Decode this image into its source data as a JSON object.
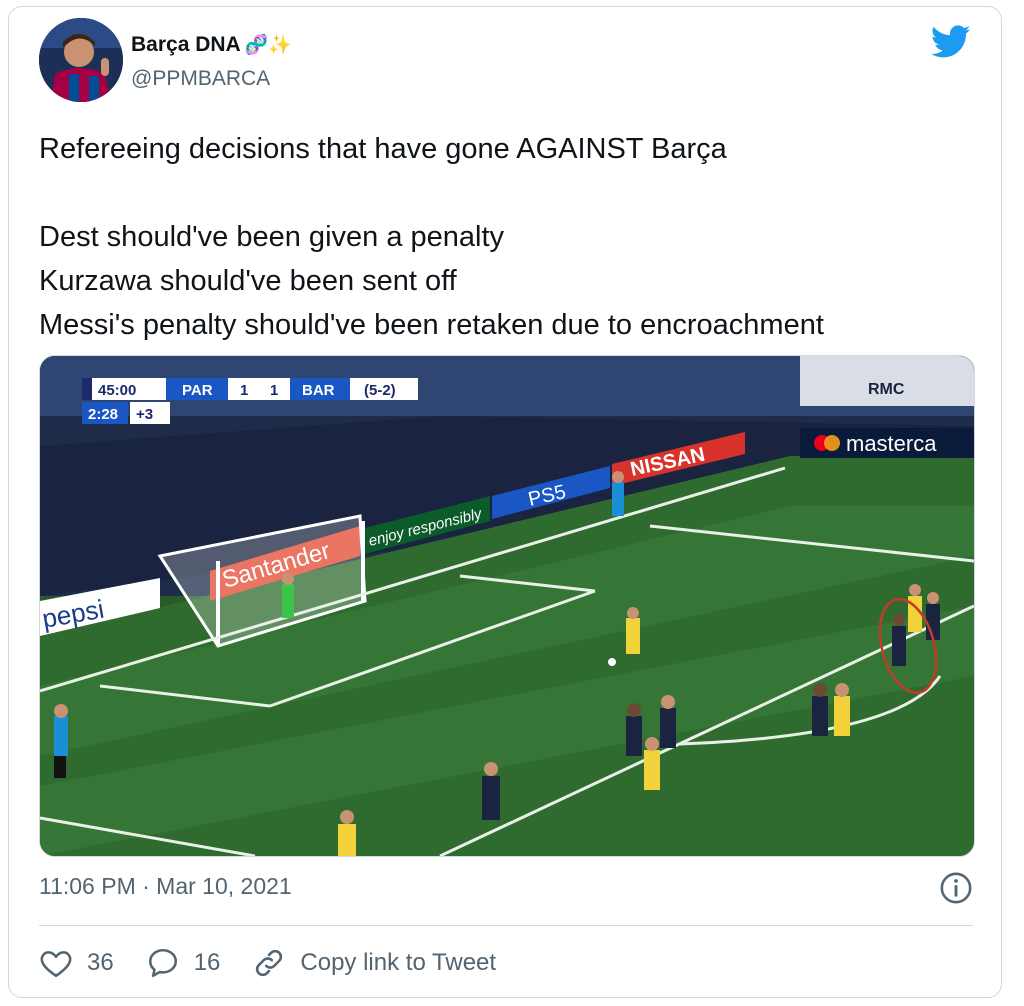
{
  "tweet": {
    "author_name": "Barça DNA",
    "author_emoji": "🧬✨",
    "handle": "@PPMBARCA",
    "lines": [
      "Refereeing decisions that have gone AGAINST Barça",
      "",
      "Dest should've been given a penalty",
      "Kurzawa should've been sent off",
      "Messi's penalty should've been retaken due to encroachment"
    ],
    "timestamp": "11:06 PM · Mar 10, 2021"
  },
  "actions": {
    "likes": "36",
    "replies": "16",
    "copy_link_label": "Copy link to Tweet"
  },
  "media": {
    "scorebug": {
      "time": "45:00",
      "home": "PAR",
      "home_score": "1",
      "away_score": "1",
      "away": "BAR",
      "aggregate": "(5-2)",
      "added_clock": "2:28",
      "added_time": "+3"
    },
    "boards": {
      "santander": "Santander",
      "pepsi": "pepsi",
      "heineken": "enjoy responsibly",
      "ps5": "PS5",
      "nissan": "NISSAN",
      "mastercard": "masterca",
      "broadcaster": "RMC"
    }
  },
  "colors": {
    "twitter_blue": "#1d9bf0",
    "text_secondary": "#536471",
    "border": "#cfd9de",
    "pitch": "#2f6b2e"
  },
  "icons": [
    "twitter-bird-icon",
    "info-icon",
    "heart-icon",
    "reply-icon",
    "link-icon"
  ]
}
